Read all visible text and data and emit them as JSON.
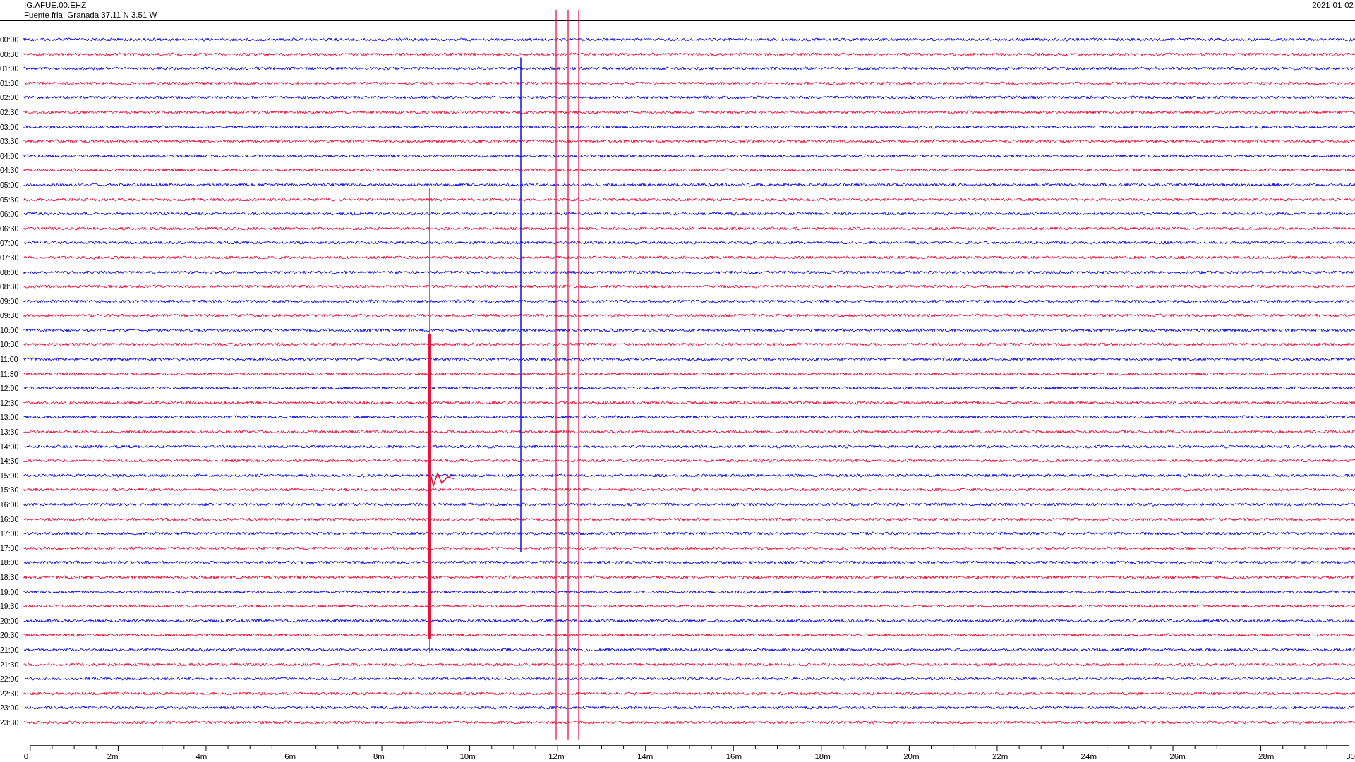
{
  "header": {
    "station": "IG.AFUE.00.EHZ",
    "location": "Fuente fria, Granada  37.11 N 3.51 W",
    "date": "2021-01-02"
  },
  "rows": [
    {
      "time": "00:00",
      "color": "#1010e0"
    },
    {
      "time": "00:30",
      "color": "#e8143c"
    },
    {
      "time": "01:00",
      "color": "#1010e0"
    },
    {
      "time": "01:30",
      "color": "#e8143c"
    },
    {
      "time": "02:00",
      "color": "#1010e0"
    },
    {
      "time": "02:30",
      "color": "#e8143c"
    },
    {
      "time": "03:00",
      "color": "#1010e0"
    },
    {
      "time": "03:30",
      "color": "#e8143c"
    },
    {
      "time": "04:00",
      "color": "#1010e0"
    },
    {
      "time": "04:30",
      "color": "#e8143c"
    },
    {
      "time": "05:00",
      "color": "#1010e0"
    },
    {
      "time": "05:30",
      "color": "#e8143c"
    },
    {
      "time": "06:00",
      "color": "#1010e0"
    },
    {
      "time": "06:30",
      "color": "#e8143c"
    },
    {
      "time": "07:00",
      "color": "#1010e0"
    },
    {
      "time": "07:30",
      "color": "#e8143c"
    },
    {
      "time": "08:00",
      "color": "#1010e0"
    },
    {
      "time": "08:30",
      "color": "#e8143c"
    },
    {
      "time": "09:00",
      "color": "#1010e0"
    },
    {
      "time": "09:30",
      "color": "#e8143c"
    },
    {
      "time": "10:00",
      "color": "#1010e0"
    },
    {
      "time": "10:30",
      "color": "#e8143c"
    },
    {
      "time": "11:00",
      "color": "#1010e0"
    },
    {
      "time": "11:30",
      "color": "#e8143c"
    },
    {
      "time": "12:00",
      "color": "#1010e0"
    },
    {
      "time": "12:30",
      "color": "#e8143c"
    },
    {
      "time": "13:00",
      "color": "#1010e0"
    },
    {
      "time": "13:30",
      "color": "#e8143c"
    },
    {
      "time": "14:00",
      "color": "#1010e0"
    },
    {
      "time": "14:30",
      "color": "#e8143c"
    },
    {
      "time": "15:00",
      "color": "#1010e0"
    },
    {
      "time": "15:30",
      "color": "#e8143c"
    },
    {
      "time": "16:00",
      "color": "#1010e0"
    },
    {
      "time": "16:30",
      "color": "#e8143c"
    },
    {
      "time": "17:00",
      "color": "#1010e0"
    },
    {
      "time": "17:30",
      "color": "#e8143c"
    },
    {
      "time": "18:00",
      "color": "#1010e0"
    },
    {
      "time": "18:30",
      "color": "#e8143c"
    },
    {
      "time": "19:00",
      "color": "#1010e0"
    },
    {
      "time": "19:30",
      "color": "#e8143c"
    },
    {
      "time": "20:00",
      "color": "#1010e0"
    },
    {
      "time": "20:30",
      "color": "#e8143c"
    },
    {
      "time": "21:00",
      "color": "#1010e0"
    },
    {
      "time": "21:30",
      "color": "#e8143c"
    },
    {
      "time": "22:00",
      "color": "#1010e0"
    },
    {
      "time": "22:30",
      "color": "#e8143c"
    },
    {
      "time": "23:00",
      "color": "#1010e0"
    },
    {
      "time": "23:30",
      "color": "#e8143c"
    }
  ],
  "x_axis_labels": [
    "0",
    "2m",
    "4m",
    "6m",
    "8m",
    "10m",
    "12m",
    "14m",
    "16m",
    "18m",
    "20m",
    "22m",
    "24m",
    "26m",
    "28m",
    "30"
  ]
}
